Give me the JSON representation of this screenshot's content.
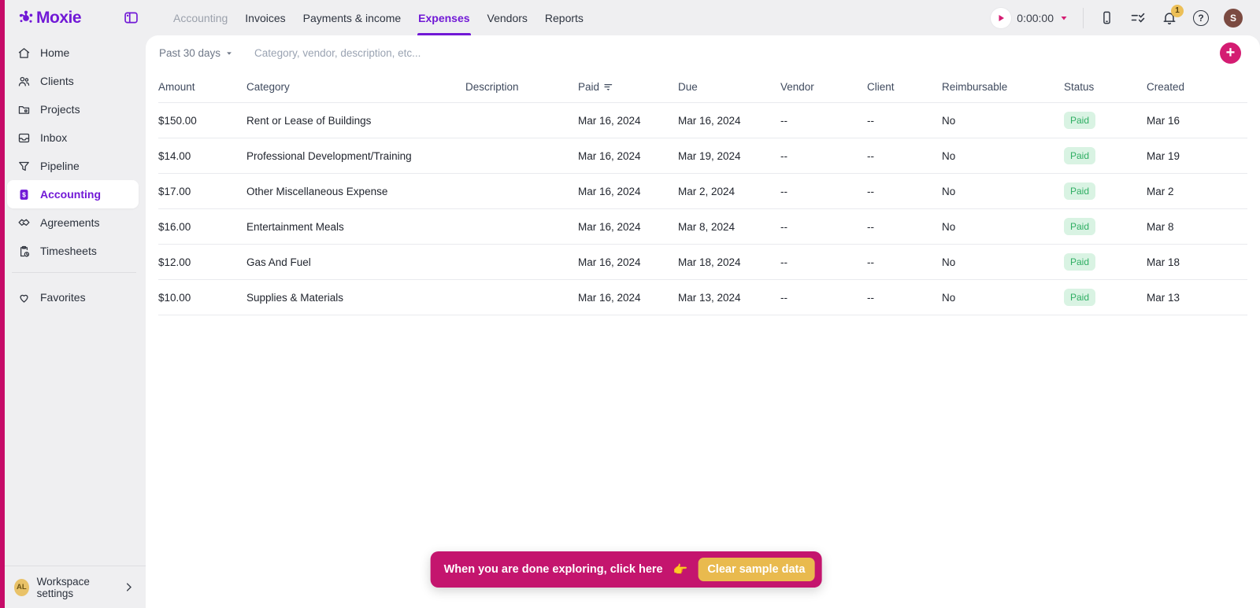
{
  "brand": {
    "name": "Moxie",
    "accent_purple": "#7119d6",
    "accent_magenta": "#c60b68"
  },
  "topnav": {
    "items": [
      {
        "label": "Accounting",
        "state": "muted"
      },
      {
        "label": "Invoices",
        "state": "normal"
      },
      {
        "label": "Payments & income",
        "state": "normal"
      },
      {
        "label": "Expenses",
        "state": "active"
      },
      {
        "label": "Vendors",
        "state": "normal"
      },
      {
        "label": "Reports",
        "state": "normal"
      }
    ]
  },
  "topbar_right": {
    "timer_value": "0:00:00",
    "notification_count": "1",
    "avatar_initial": "S"
  },
  "sidebar": {
    "items": [
      {
        "label": "Home",
        "icon": "home-icon",
        "active": false
      },
      {
        "label": "Clients",
        "icon": "clients-icon",
        "active": false
      },
      {
        "label": "Projects",
        "icon": "projects-icon",
        "active": false
      },
      {
        "label": "Inbox",
        "icon": "inbox-icon",
        "active": false
      },
      {
        "label": "Pipeline",
        "icon": "pipeline-icon",
        "active": false
      },
      {
        "label": "Accounting",
        "icon": "accounting-icon",
        "active": true
      },
      {
        "label": "Agreements",
        "icon": "agreements-icon",
        "active": false
      },
      {
        "label": "Timesheets",
        "icon": "timesheets-icon",
        "active": false
      }
    ],
    "favorites": {
      "label": "Favorites",
      "icon": "heart-icon"
    },
    "workspace": {
      "label": "Workspace settings",
      "avatar_initials": "AL"
    }
  },
  "filters": {
    "date_range": "Past 30 days",
    "search_placeholder": "Category, vendor, description, etc..."
  },
  "table": {
    "columns": [
      "Amount",
      "Category",
      "Description",
      "Paid",
      "Due",
      "Vendor",
      "Client",
      "Reimbursable",
      "Status",
      "Created"
    ],
    "sorted_column": "Paid",
    "rows": [
      {
        "amount": "$150.00",
        "category": "Rent or Lease of Buildings",
        "description": "",
        "paid": "Mar 16, 2024",
        "due": "Mar 16, 2024",
        "vendor": "--",
        "client": "--",
        "reimbursable": "No",
        "status": "Paid",
        "created": "Mar 16"
      },
      {
        "amount": "$14.00",
        "category": "Professional Development/Training",
        "description": "",
        "paid": "Mar 16, 2024",
        "due": "Mar 19, 2024",
        "vendor": "--",
        "client": "--",
        "reimbursable": "No",
        "status": "Paid",
        "created": "Mar 19"
      },
      {
        "amount": "$17.00",
        "category": "Other Miscellaneous Expense",
        "description": "",
        "paid": "Mar 16, 2024",
        "due": "Mar 2, 2024",
        "vendor": "--",
        "client": "--",
        "reimbursable": "No",
        "status": "Paid",
        "created": "Mar 2"
      },
      {
        "amount": "$16.00",
        "category": "Entertainment Meals",
        "description": "",
        "paid": "Mar 16, 2024",
        "due": "Mar 8, 2024",
        "vendor": "--",
        "client": "--",
        "reimbursable": "No",
        "status": "Paid",
        "created": "Mar 8"
      },
      {
        "amount": "$12.00",
        "category": "Gas And Fuel",
        "description": "",
        "paid": "Mar 16, 2024",
        "due": "Mar 18, 2024",
        "vendor": "--",
        "client": "--",
        "reimbursable": "No",
        "status": "Paid",
        "created": "Mar 18"
      },
      {
        "amount": "$10.00",
        "category": "Supplies & Materials",
        "description": "",
        "paid": "Mar 16, 2024",
        "due": "Mar 13, 2024",
        "vendor": "--",
        "client": "--",
        "reimbursable": "No",
        "status": "Paid",
        "created": "Mar 13"
      }
    ],
    "status_badge_colors": {
      "background": "#d9f3e3",
      "text": "#2fae63"
    }
  },
  "banner": {
    "message": "When you are done exploring, click here",
    "emoji": "👉",
    "button_label": "Clear sample data",
    "background": "#c4156e",
    "button_background": "#e9ba4e"
  }
}
